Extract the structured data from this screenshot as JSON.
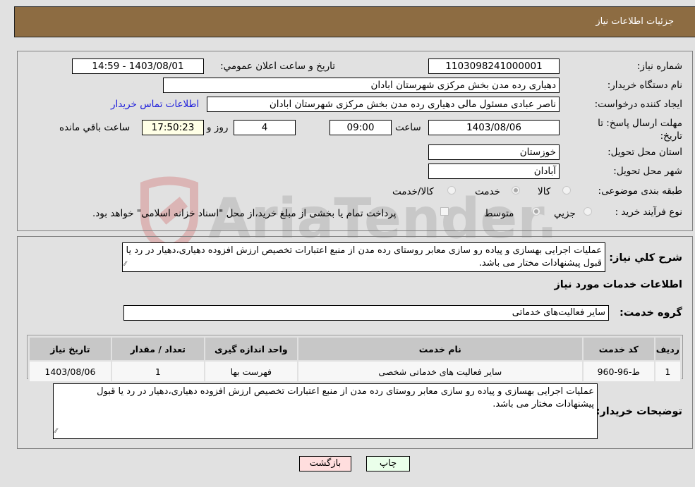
{
  "header": {
    "title": "جزئیات اطلاعات نیاز"
  },
  "form": {
    "need_number": {
      "label": "شماره نیاز:",
      "value": "1103098241000001"
    },
    "announce_datetime": {
      "label": "تاريخ و ساعت اعلان عمومي:",
      "value": "1403/08/01 - 14:59"
    },
    "buyer_org": {
      "label": "نام دستگاه خریدار:",
      "value": "دهیاری رده مدن بخش مرکزی شهرستان ابادان"
    },
    "requester": {
      "label": "ایجاد کننده درخواست:",
      "value": "ناصر عبادی مسئول مالی دهیاری رده مدن بخش مرکزی شهرستان ابادان"
    },
    "buyer_contact_link": "اطلاعات تماس خریدار",
    "deadline": {
      "label": "مهلت ارسال پاسخ: تا تاریخ:",
      "date": "1403/08/06",
      "time_label": "ساعت",
      "time": "09:00",
      "days": "4",
      "days_label": "روز و",
      "remaining": "17:50:23",
      "remaining_label": "ساعت باقي مانده"
    },
    "province": {
      "label": "استان محل تحویل:",
      "value": "خوزستان"
    },
    "city": {
      "label": "شهر محل تحویل:",
      "value": "آبادان"
    },
    "category": {
      "label": "طبقه بندی موضوعی:",
      "options": [
        "کالا",
        "خدمت",
        "کالا/خدمت"
      ],
      "selected": "خدمت"
    },
    "purchase_type": {
      "label": "نوع فرآیند خرید :",
      "options": [
        "جزيي",
        "متوسط"
      ],
      "selected": "متوسط",
      "treasury_note": "پرداخت تمام یا بخشی از مبلغ خرید،از محل \"اسناد خزانه اسلامی\" خواهد بود.",
      "treasury_checked": false
    }
  },
  "details": {
    "description_label": "شرح كلي نياز:",
    "description": "عملیات اجرایی بهسازی و پیاده رو سازی معابر روستای رده مدن از منبع اعتبارات تخصیص ارزش افزوده دهیاری،دهیار در رد یا قبول پیشنهادات مختار می باشد.",
    "services_heading": "اطلاعات خدمات مورد نياز",
    "service_group_label": "گروه خدمت:",
    "service_group": "سایر فعالیت‌های خدماتی",
    "table": {
      "headers": [
        "ردیف",
        "کد خدمت",
        "نام خدمت",
        "واحد اندازه گیری",
        "تعداد / مقدار",
        "تاریخ نیاز"
      ],
      "rows": [
        [
          "1",
          "ط-96-960",
          "سایر فعالیت های خدماتی شخصی",
          "فهرست بها",
          "1",
          "1403/08/06"
        ]
      ]
    },
    "buyer_notes_label": "توضیحات خریدار:",
    "buyer_notes": "عملیات اجرایی بهسازی و پیاده رو سازی معابر روستای رده مدن از منبع اعتبارات تخصیص ارزش افزوده دهیاری،دهیار در رد یا قبول پیشنهادات مختار می باشد."
  },
  "buttons": {
    "print": "چاپ",
    "back": "بازگشت"
  },
  "watermark": {
    "text": "AriaTender.neT"
  }
}
